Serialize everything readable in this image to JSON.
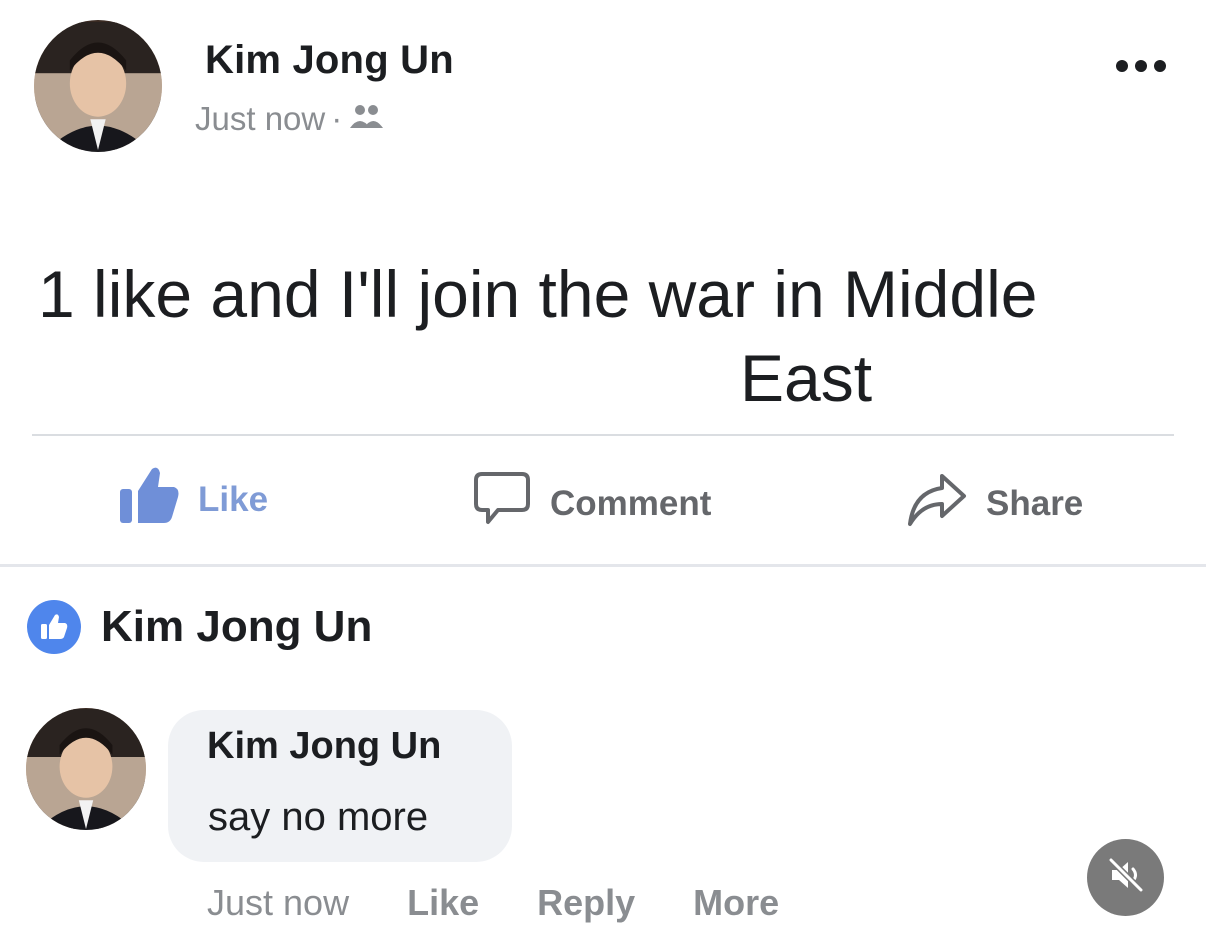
{
  "post": {
    "author": "Kim Jong Un",
    "timestamp": "Just now",
    "separator": "·",
    "audience_icon": "friends-icon",
    "text_line1": "1 like and I'll join the war in Middle",
    "text_line2": "East",
    "more_icon": "more-options-icon"
  },
  "actions": {
    "like": "Like",
    "comment": "Comment",
    "share": "Share"
  },
  "reaction": {
    "icon": "like-badge-icon",
    "name": "Kim Jong Un"
  },
  "comment": {
    "author": "Kim Jong Un",
    "text": "say no more",
    "timestamp": "Just now",
    "like": "Like",
    "reply": "Reply",
    "more": "More"
  },
  "media": {
    "mute_icon": "muted-speaker-icon"
  },
  "colors": {
    "like_blue": "#7f9bd6",
    "badge_blue": "#4f86ec",
    "meta_gray": "#8a8d91",
    "bubble_bg": "#f0f2f5"
  }
}
